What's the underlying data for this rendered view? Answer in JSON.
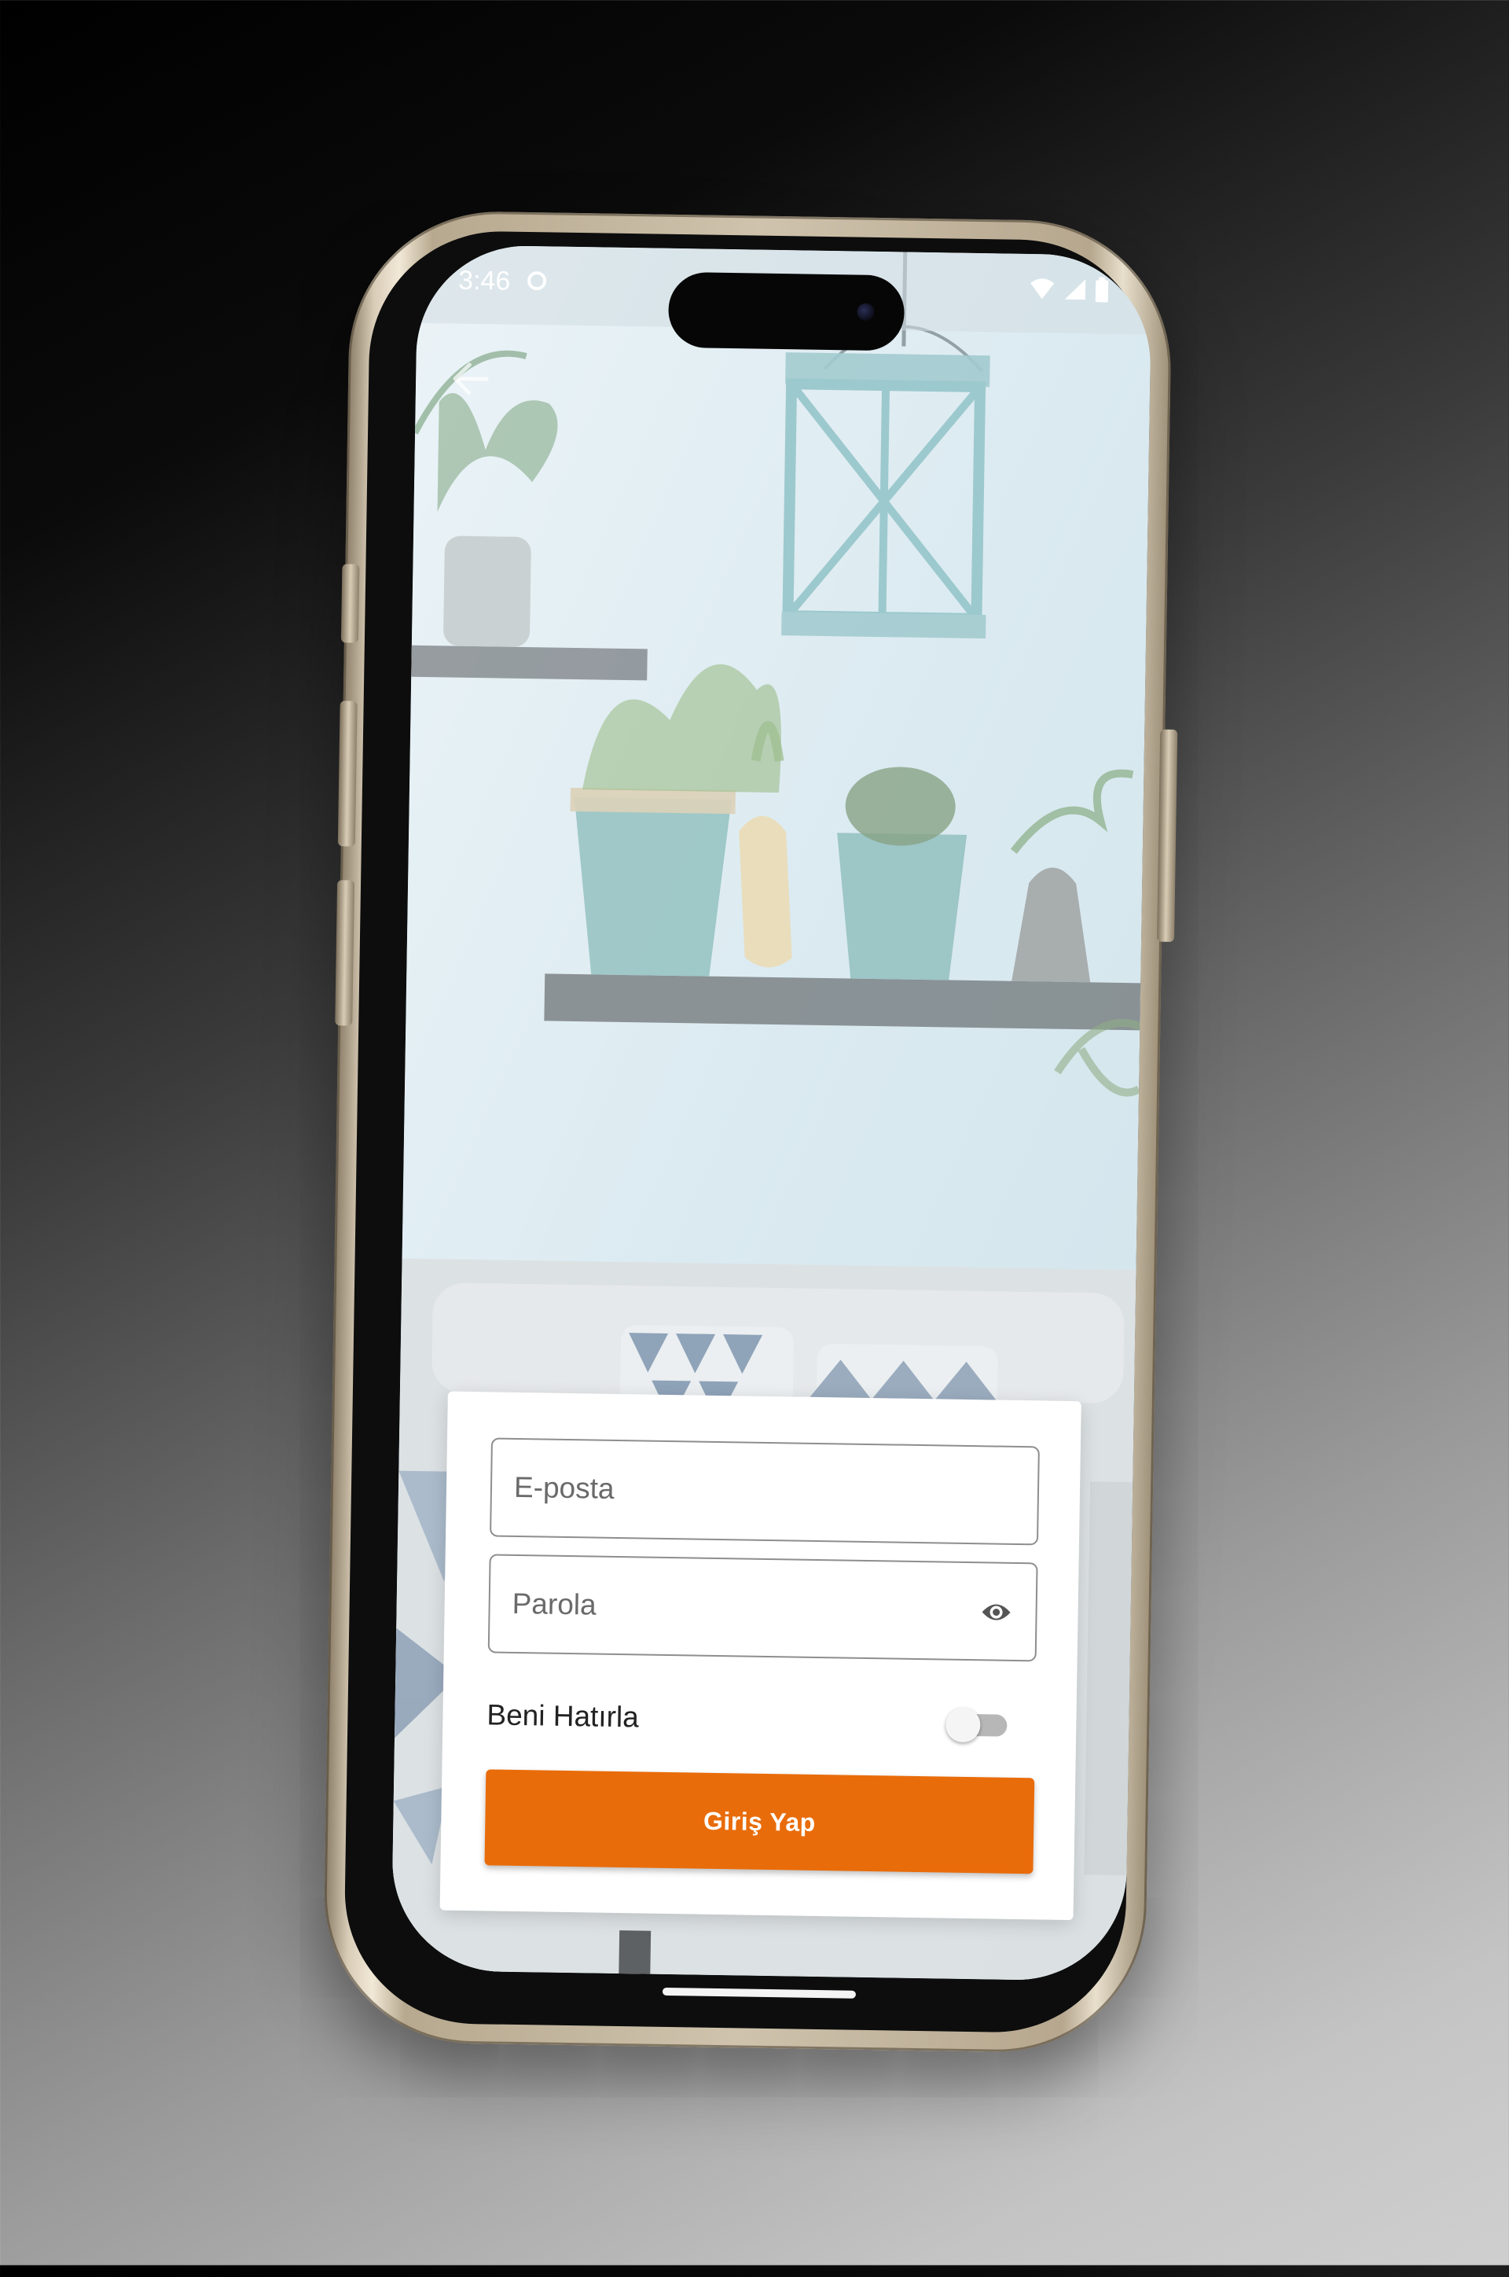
{
  "status_bar": {
    "time": "3:46",
    "icons": [
      "sync-status-icon",
      "wifi-icon",
      "signal-icon",
      "battery-icon"
    ]
  },
  "nav": {
    "back_icon": "back-arrow-icon"
  },
  "login_form": {
    "email": {
      "placeholder": "E-posta",
      "value": ""
    },
    "password": {
      "placeholder": "Parola",
      "value": "",
      "visibility_icon": "eye-icon"
    },
    "remember_me": {
      "label": "Beni Hatırla",
      "enabled": false
    },
    "submit_label": "Giriş Yap"
  },
  "colors": {
    "accent": "#e96c0a",
    "card_background": "#ffffff",
    "field_border": "#8e8e8e",
    "toggle_off": "#b7b7b7"
  }
}
